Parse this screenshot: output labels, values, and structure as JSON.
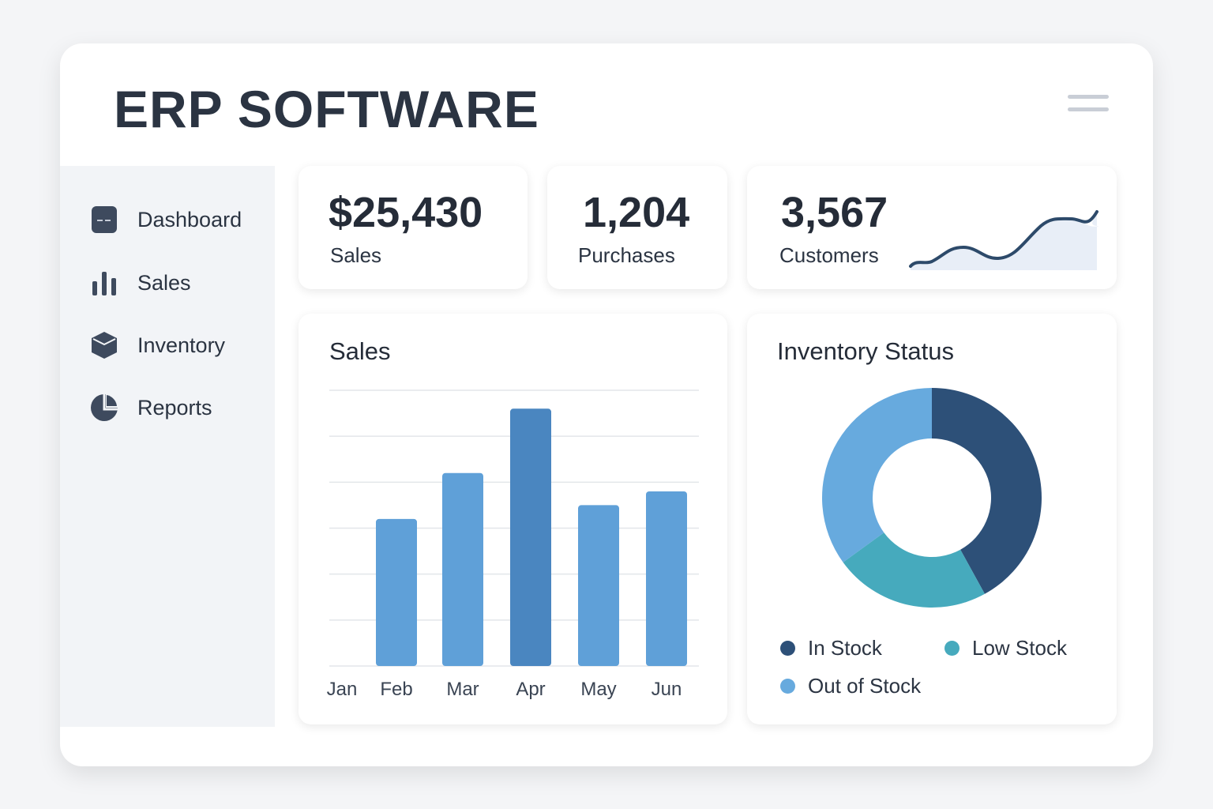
{
  "header": {
    "title": "ERP SOFTWARE",
    "menu_icon": "hamburger-icon"
  },
  "sidebar": {
    "items": [
      {
        "label": "Dashboard",
        "icon": "dashboard-icon"
      },
      {
        "label": "Sales",
        "icon": "bar-chart-icon"
      },
      {
        "label": "Inventory",
        "icon": "box-icon"
      },
      {
        "label": "Reports",
        "icon": "pie-chart-icon"
      }
    ]
  },
  "stats": [
    {
      "value": "$25,430",
      "label": "Sales"
    },
    {
      "value": "1,204",
      "label": "Purchases"
    },
    {
      "value": "3,567",
      "label": "Customers"
    }
  ],
  "colors": {
    "dark": "#2d5078",
    "teal": "#46aabd",
    "light": "#67aade",
    "bar": "#5fa0d8",
    "bar_highlight": "#4a86c0"
  },
  "chart_data": [
    {
      "type": "bar",
      "title": "Sales",
      "categories": [
        "Jan",
        "Feb",
        "Mar",
        "Apr",
        "May",
        "Jun"
      ],
      "values": [
        null,
        3.2,
        4.2,
        5.6,
        3.5,
        3.8
      ],
      "ylim": [
        0,
        6
      ],
      "grid": true,
      "highlight": "Apr",
      "xlabel": "",
      "ylabel": ""
    },
    {
      "type": "pie",
      "title": "Inventory Status",
      "categories": [
        "In Stock",
        "Low Stock",
        "Out of Stock"
      ],
      "values": [
        42,
        23,
        35
      ],
      "donut": true,
      "legend": "bottom"
    },
    {
      "type": "line",
      "title": "Customers trend",
      "values": [
        1,
        1.6,
        1.1,
        2.4,
        2.9,
        2.7,
        3.3
      ]
    }
  ]
}
